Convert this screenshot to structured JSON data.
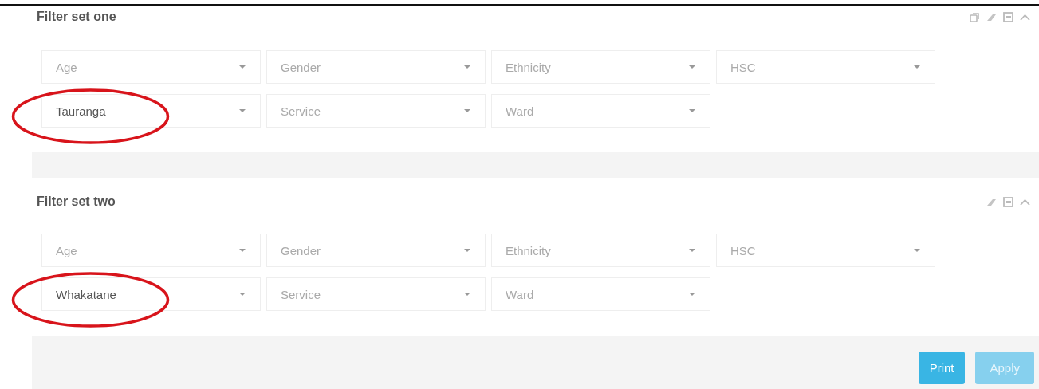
{
  "panels": [
    {
      "title": "Filter set one",
      "icons": [
        {
          "kind": "copy"
        },
        {
          "kind": "eraser"
        },
        {
          "kind": "maximize"
        },
        {
          "kind": "collapse"
        }
      ],
      "rows": [
        [
          {
            "placeholder": "Age",
            "highlighted": false
          },
          {
            "placeholder": "Gender",
            "highlighted": false
          },
          {
            "placeholder": "Ethnicity",
            "highlighted": false
          },
          {
            "placeholder": "HSC",
            "highlighted": false
          }
        ],
        [
          {
            "value": "Tauranga",
            "highlighted": true
          },
          {
            "placeholder": "Service",
            "highlighted": false
          },
          {
            "placeholder": "Ward",
            "highlighted": false
          }
        ]
      ]
    },
    {
      "title": "Filter set two",
      "icons": [
        {
          "kind": "eraser"
        },
        {
          "kind": "maximize"
        },
        {
          "kind": "collapse"
        }
      ],
      "rows": [
        [
          {
            "placeholder": "Age",
            "highlighted": false
          },
          {
            "placeholder": "Gender",
            "highlighted": false
          },
          {
            "placeholder": "Ethnicity",
            "highlighted": false
          },
          {
            "placeholder": "HSC",
            "highlighted": false
          }
        ],
        [
          {
            "value": "Whakatane",
            "highlighted": true
          },
          {
            "placeholder": "Service",
            "highlighted": false
          },
          {
            "placeholder": "Ward",
            "highlighted": false
          }
        ]
      ],
      "buttons": [
        {
          "label": "Print",
          "disabled": false
        },
        {
          "label": "Apply",
          "disabled": true
        }
      ]
    }
  ]
}
